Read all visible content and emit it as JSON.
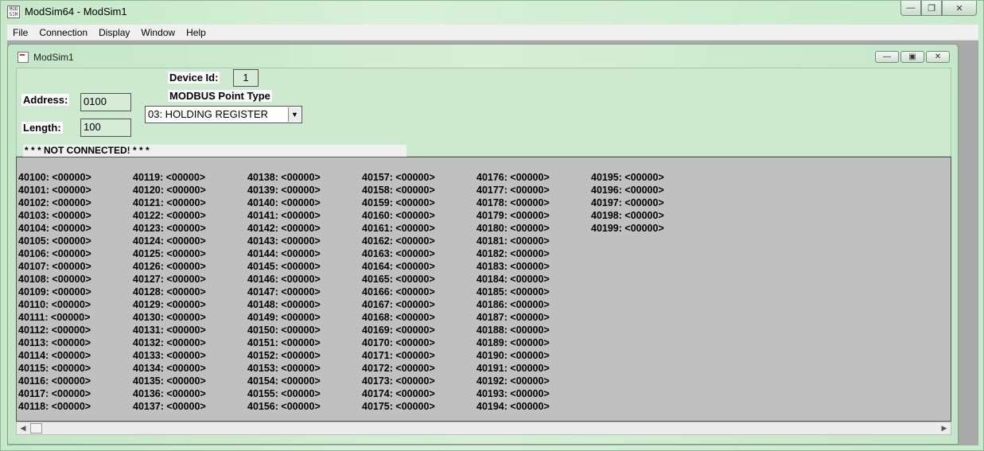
{
  "window": {
    "title": "ModSim64 - ModSim1",
    "icon_text": "MOD SIM"
  },
  "menu": [
    "File",
    "Connection",
    "Display",
    "Window",
    "Help"
  ],
  "child": {
    "title": "ModSim1"
  },
  "form": {
    "device_id_label": "Device Id:",
    "device_id_value": "1",
    "point_type_label": "MODBUS Point Type",
    "point_type_value": "03: HOLDING REGISTER",
    "address_label": "Address:",
    "address_value": "0100",
    "length_label": "Length:",
    "length_value": "100",
    "status": "* * * NOT CONNECTED! * * *"
  },
  "registers": {
    "columns": [
      [
        "40100: <00000>",
        "40101: <00000>",
        "40102: <00000>",
        "40103: <00000>",
        "40104: <00000>",
        "40105: <00000>",
        "40106: <00000>",
        "40107: <00000>",
        "40108: <00000>",
        "40109: <00000>",
        "40110: <00000>",
        "40111: <00000>",
        "40112: <00000>",
        "40113: <00000>",
        "40114: <00000>",
        "40115: <00000>",
        "40116: <00000>",
        "40117: <00000>",
        "40118: <00000>"
      ],
      [
        "40119: <00000>",
        "40120: <00000>",
        "40121: <00000>",
        "40122: <00000>",
        "40123: <00000>",
        "40124: <00000>",
        "40125: <00000>",
        "40126: <00000>",
        "40127: <00000>",
        "40128: <00000>",
        "40129: <00000>",
        "40130: <00000>",
        "40131: <00000>",
        "40132: <00000>",
        "40133: <00000>",
        "40134: <00000>",
        "40135: <00000>",
        "40136: <00000>",
        "40137: <00000>"
      ],
      [
        "40138: <00000>",
        "40139: <00000>",
        "40140: <00000>",
        "40141: <00000>",
        "40142: <00000>",
        "40143: <00000>",
        "40144: <00000>",
        "40145: <00000>",
        "40146: <00000>",
        "40147: <00000>",
        "40148: <00000>",
        "40149: <00000>",
        "40150: <00000>",
        "40151: <00000>",
        "40152: <00000>",
        "40153: <00000>",
        "40154: <00000>",
        "40155: <00000>",
        "40156: <00000>"
      ],
      [
        "40157: <00000>",
        "40158: <00000>",
        "40159: <00000>",
        "40160: <00000>",
        "40161: <00000>",
        "40162: <00000>",
        "40163: <00000>",
        "40164: <00000>",
        "40165: <00000>",
        "40166: <00000>",
        "40167: <00000>",
        "40168: <00000>",
        "40169: <00000>",
        "40170: <00000>",
        "40171: <00000>",
        "40172: <00000>",
        "40173: <00000>",
        "40174: <00000>",
        "40175: <00000>"
      ],
      [
        "40176: <00000>",
        "40177: <00000>",
        "40178: <00000>",
        "40179: <00000>",
        "40180: <00000>",
        "40181: <00000>",
        "40182: <00000>",
        "40183: <00000>",
        "40184: <00000>",
        "40185: <00000>",
        "40186: <00000>",
        "40187: <00000>",
        "40188: <00000>",
        "40189: <00000>",
        "40190: <00000>",
        "40191: <00000>",
        "40192: <00000>",
        "40193: <00000>",
        "40194: <00000>"
      ],
      [
        "40195: <00000>",
        "40196: <00000>",
        "40197: <00000>",
        "40198: <00000>",
        "40199: <00000>"
      ]
    ]
  }
}
